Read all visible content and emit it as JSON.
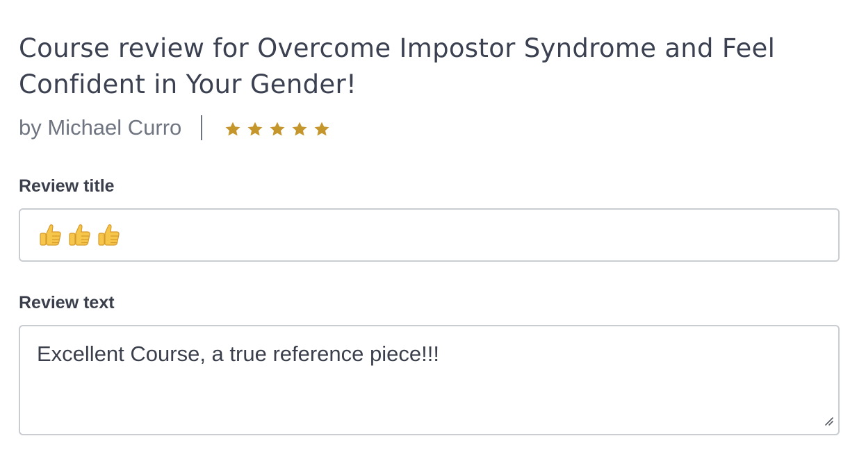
{
  "review": {
    "heading": "Course review for Overcome Impostor Syndrome and Feel Confident in Your Gender!",
    "author": "by Michael Curro",
    "rating": 5,
    "rating_max": 5,
    "star_color": "#c4962c"
  },
  "form": {
    "title_label": "Review title",
    "title_value": "👍👍👍",
    "text_label": "Review text",
    "text_value": "Excellent Course, a true reference piece!!!"
  },
  "icons": {
    "star": "star-icon",
    "thumbs_up": "thumbs-up-icon",
    "resize": "resize-handle-icon"
  }
}
